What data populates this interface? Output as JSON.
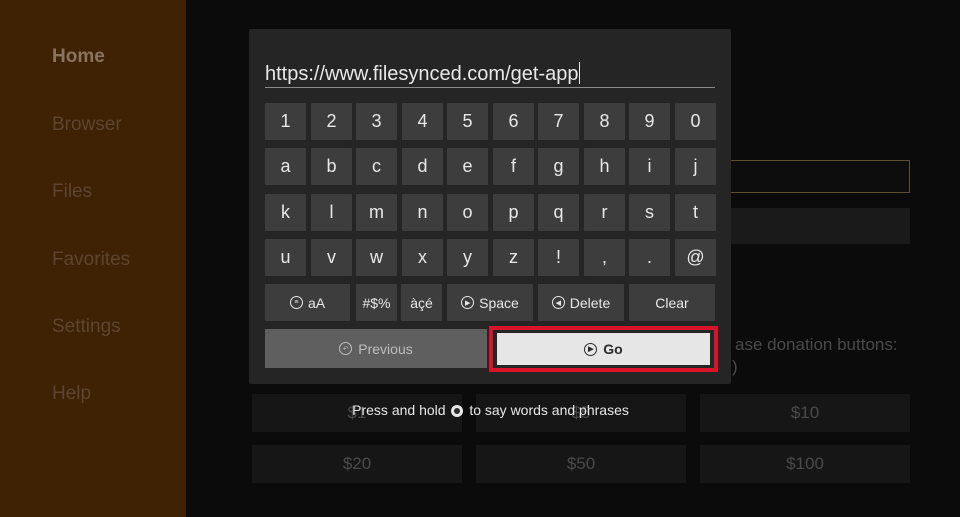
{
  "sidebar": {
    "items": [
      {
        "label": "Home",
        "active": true
      },
      {
        "label": "Browser"
      },
      {
        "label": "Files"
      },
      {
        "label": "Favorites"
      },
      {
        "label": "Settings"
      },
      {
        "label": "Help"
      }
    ]
  },
  "background": {
    "donation_text": "ase donation buttons:",
    "donation_text2": ")",
    "amounts": [
      "$1",
      "$5",
      "$10",
      "$20",
      "$50",
      "$100"
    ]
  },
  "keyboard": {
    "url_value": "https://www.filesynced.com/get-app",
    "rows": [
      [
        "1",
        "2",
        "3",
        "4",
        "5",
        "6",
        "7",
        "8",
        "9",
        "0"
      ],
      [
        "a",
        "b",
        "c",
        "d",
        "e",
        "f",
        "g",
        "h",
        "i",
        "j"
      ],
      [
        "k",
        "l",
        "m",
        "n",
        "o",
        "p",
        "q",
        "r",
        "s",
        "t"
      ],
      [
        "u",
        "v",
        "w",
        "x",
        "y",
        "z",
        "!",
        ",",
        ".",
        "@"
      ]
    ],
    "case_label": "aA",
    "symbols_label": "#$%",
    "accents_label": "àçé",
    "space_label": "Space",
    "delete_label": "Delete",
    "clear_label": "Clear",
    "previous_label": "Previous",
    "go_label": "Go",
    "hint_before": "Press and hold",
    "hint_after": "to say words and phrases"
  },
  "colors": {
    "sidebar_bg": "#3f2103",
    "highlight": "#d8132a",
    "key_bg": "#3d3d3d"
  }
}
